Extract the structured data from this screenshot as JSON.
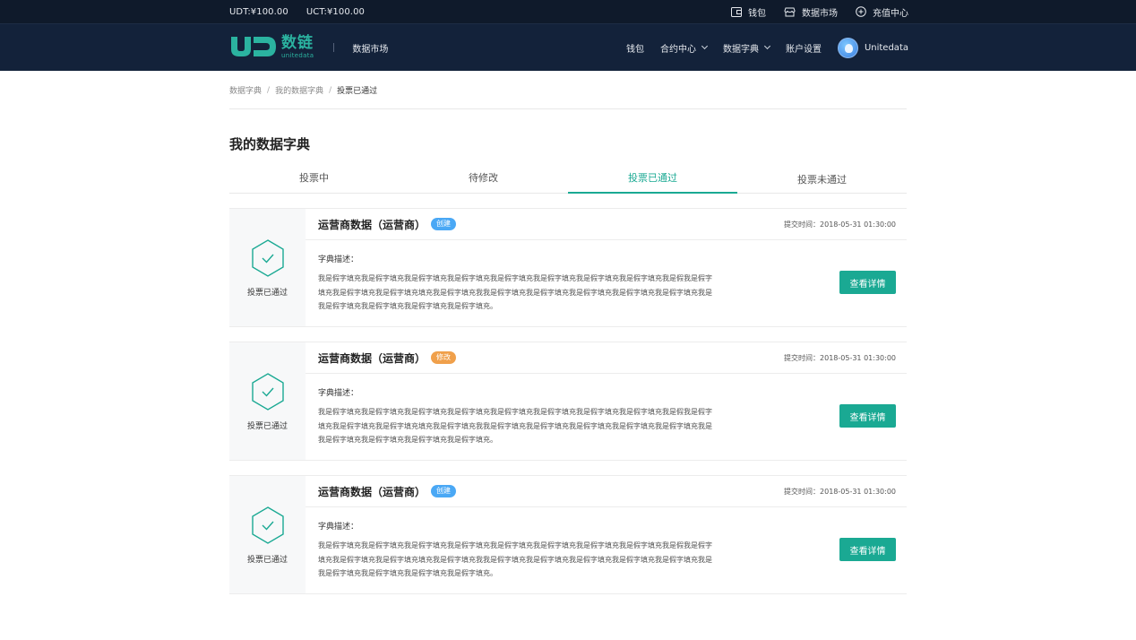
{
  "topbar": {
    "udt_balance": "UDT:¥100.00",
    "uct_balance": "UCT:¥100.00",
    "links": [
      {
        "label": "钱包",
        "icon": "wallet-icon"
      },
      {
        "label": "数据市场",
        "icon": "store-icon"
      },
      {
        "label": "充值中心",
        "icon": "recharge-icon"
      }
    ]
  },
  "header": {
    "logo_mark": "UD",
    "logo_cn": "数链",
    "logo_en": "unitedata",
    "subtitle": "数据市场",
    "nav": [
      {
        "label": "钱包",
        "dropdown": false
      },
      {
        "label": "合约中心",
        "dropdown": true
      },
      {
        "label": "数据字典",
        "dropdown": true
      },
      {
        "label": "账户设置",
        "dropdown": false
      }
    ],
    "username": "Unitedata"
  },
  "breadcrumb": {
    "items": [
      "数据字典",
      "我的数据字典"
    ],
    "current": "投票已通过",
    "separator": "/"
  },
  "page_title": "我的数据字典",
  "tabs": [
    {
      "label": "投票中",
      "active": false
    },
    {
      "label": "待修改",
      "active": false
    },
    {
      "label": "投票已通过",
      "active": true
    },
    {
      "label": "投票未通过",
      "active": false
    }
  ],
  "colors": {
    "accent": "#1aa993",
    "badge_create": "#4aa8f5",
    "badge_modify": "#f0a04b",
    "header_bg": "#13223a",
    "topbar_bg": "#0f1a2b"
  },
  "cards": [
    {
      "status": "投票已通过",
      "title": "运营商数据（运营商）",
      "badge": "创建",
      "badge_type": "create",
      "submit_time": "提交时间：2018-05-31 01:30:00",
      "desc_label": "字典描述：",
      "desc_lines": [
        "我是假字填充我是假字填充我是假字填充我是假字填充我是假字填充我是假字填充我是假字填充我是假字填充我是假我是假字",
        "填充我是假字填充我是假字填充填充我是假字填充我我是假字填充我是假字填充我是假字填充我是假字填充我是假字填充我是",
        "我是假字填充我是假字填充我是假字填充我是假字填充。"
      ],
      "button": "查看详情"
    },
    {
      "status": "投票已通过",
      "title": "运营商数据（运营商）",
      "badge": "修改",
      "badge_type": "modify",
      "submit_time": "提交时间：2018-05-31 01:30:00",
      "desc_label": "字典描述：",
      "desc_lines": [
        "我是假字填充我是假字填充我是假字填充我是假字填充我是假字填充我是假字填充我是假字填充我是假字填充我是假我是假字",
        "填充我是假字填充我是假字填充填充我是假字填充我我是假字填充我是假字填充我是假字填充我是假字填充我是假字填充我是",
        "我是假字填充我是假字填充我是假字填充我是假字填充。"
      ],
      "button": "查看详情"
    },
    {
      "status": "投票已通过",
      "title": "运营商数据（运营商）",
      "badge": "创建",
      "badge_type": "create",
      "submit_time": "提交时间：2018-05-31 01:30:00",
      "desc_label": "字典描述：",
      "desc_lines": [
        "我是假字填充我是假字填充我是假字填充我是假字填充我是假字填充我是假字填充我是假字填充我是假字填充我是假我是假字",
        "填充我是假字填充我是假字填充填充我是假字填充我我是假字填充我是假字填充我是假字填充我是假字填充我是假字填充我是",
        "我是假字填充我是假字填充我是假字填充我是假字填充。"
      ],
      "button": "查看详情"
    }
  ]
}
